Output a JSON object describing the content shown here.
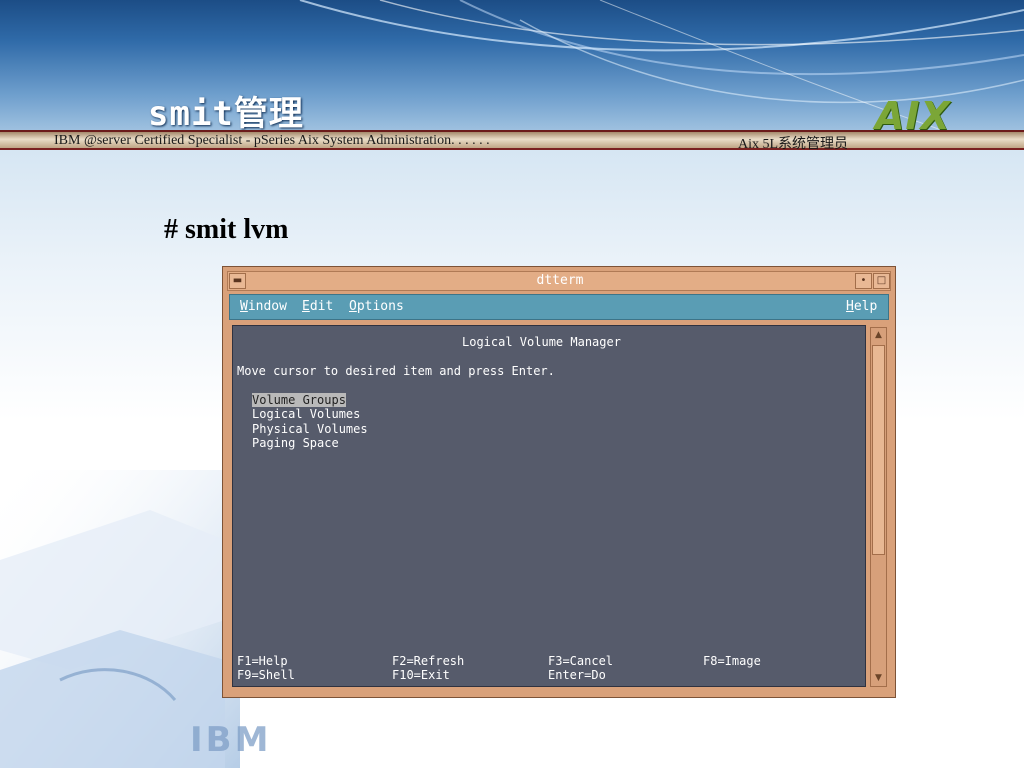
{
  "slide": {
    "title": "smit管理",
    "header_left": "IBM @server Certified Specialist - pSeries Aix System Administration. . . . . .",
    "header_right": "Aix 5L系统管理员",
    "command": "# smit lvm",
    "logo": "AIX",
    "ibm_watermark": "IBM"
  },
  "window": {
    "title": "dtterm",
    "buttons": {
      "menu_icon": "window-menu-icon",
      "minimize_icon": "minimize-icon",
      "maximize_icon": "maximize-icon"
    },
    "menubar": {
      "window": {
        "mnemonic": "W",
        "rest": "indow"
      },
      "edit": {
        "mnemonic": "E",
        "rest": "dit"
      },
      "options": {
        "mnemonic": "O",
        "rest": "ptions"
      },
      "help": {
        "mnemonic": "H",
        "rest": "elp"
      }
    },
    "terminal": {
      "heading": "Logical Volume Manager",
      "instruction": "Move cursor to desired item and press Enter.",
      "items": [
        "Volume Groups",
        "Logical Volumes",
        "Physical Volumes",
        "Paging Space"
      ],
      "selected_index": 0,
      "keys_row1": [
        "F1=Help",
        "F2=Refresh",
        "F3=Cancel",
        "F8=Image"
      ],
      "keys_row2": [
        "F9=Shell",
        "F10=Exit",
        "Enter=Do"
      ]
    }
  },
  "colors": {
    "window_frame": "#d9a17a",
    "menubar": "#5a9db4",
    "terminal_bg": "#565b6b",
    "header_bar_border": "#7a2020",
    "logo_green": "#7ba637"
  }
}
